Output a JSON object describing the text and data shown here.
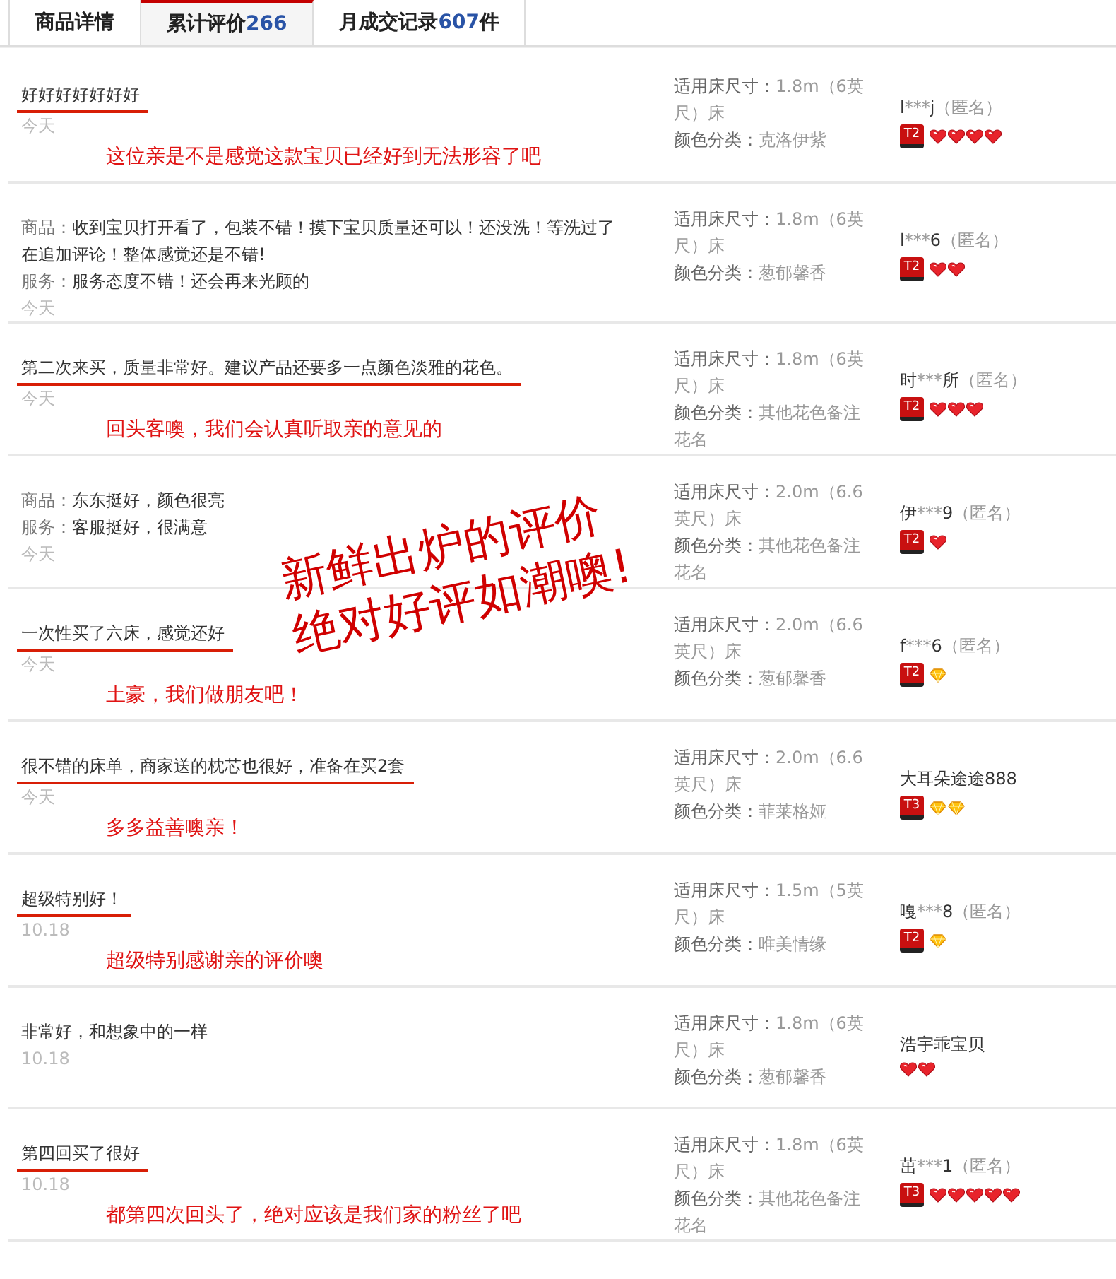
{
  "tabs": [
    {
      "label": "商品详情",
      "selected": false
    },
    {
      "label": "累计评价",
      "count": "266",
      "selected": true
    },
    {
      "label": "月成交记录",
      "count": "607",
      "suffix": "件",
      "selected": false
    }
  ],
  "reviews": [
    {
      "lines": [
        {
          "text": "好好好好好好好"
        }
      ],
      "date": "今天",
      "reply": "这位亲是不是感觉这款宝贝已经好到无法形容了吧",
      "size_label": "适用床尺寸：",
      "size": "1.8m（6英尺）床",
      "color_label": "颜色分类：",
      "color_name": "克洛伊紫",
      "user": {
        "head": "l",
        "mask": "***",
        "tail": "j",
        "anon": "（匿名）"
      },
      "badge": "T2",
      "rank_icons": [
        {
          "kind": "heart"
        },
        {
          "kind": "heart"
        },
        {
          "kind": "heart"
        },
        {
          "kind": "heart"
        }
      ]
    },
    {
      "lines": [
        {
          "label": "商品：",
          "text": "收到宝贝打开看了，包装不错！摸下宝贝质量还可以！还没洗！等洗过了在追加评论！整体感觉还是不错!"
        },
        {
          "label": "服务：",
          "text": "服务态度不错！还会再来光顾的"
        }
      ],
      "date": "今天",
      "size_label": "适用床尺寸：",
      "size": "1.8m（6英尺）床",
      "color_label": "颜色分类：",
      "color_name": "葱郁馨香",
      "user": {
        "head": "l",
        "mask": "***",
        "tail": "6",
        "anon": "（匿名）"
      },
      "badge": "T2",
      "rank_icons": [
        {
          "kind": "heart"
        },
        {
          "kind": "heart"
        }
      ]
    },
    {
      "lines": [
        {
          "text": "第二次来买，质量非常好。建议产品还要多一点颜色淡雅的花色。"
        }
      ],
      "date": "今天",
      "reply": "回头客噢，我们会认真听取亲的意见的",
      "size_label": "适用床尺寸：",
      "size": "1.8m（6英尺）床",
      "color_label": "颜色分类：",
      "color_name": "其他花色备注花名",
      "user": {
        "head": "时",
        "mask": "***",
        "tail": "所",
        "anon": "（匿名）"
      },
      "badge": "T2",
      "rank_icons": [
        {
          "kind": "heart"
        },
        {
          "kind": "heart"
        },
        {
          "kind": "heart"
        }
      ]
    },
    {
      "lines": [
        {
          "label": "商品：",
          "text": "东东挺好，颜色很亮"
        },
        {
          "label": "服务：",
          "text": "客服挺好，很满意"
        }
      ],
      "date": "今天",
      "size_label": "适用床尺寸：",
      "size": "2.0m（6.6英尺）床",
      "color_label": "颜色分类：",
      "color_name": "其他花色备注花名",
      "user": {
        "head": "伊",
        "mask": "***",
        "tail": "9",
        "anon": "（匿名）"
      },
      "badge": "T2",
      "rank_icons": [
        {
          "kind": "heart"
        }
      ]
    },
    {
      "lines": [
        {
          "text": "一次性买了六床，感觉还好"
        }
      ],
      "date": "今天",
      "reply": "土豪，我们做朋友吧！",
      "size_label": "适用床尺寸：",
      "size": "2.0m（6.6英尺）床",
      "color_label": "颜色分类：",
      "color_name": "葱郁馨香",
      "user": {
        "head": "f",
        "mask": "***",
        "tail": "6",
        "anon": "（匿名）"
      },
      "badge": "T2",
      "rank_icons": [
        {
          "kind": "diamond"
        }
      ]
    },
    {
      "lines": [
        {
          "text": "很不错的床单，商家送的枕芯也很好，准备在买2套"
        }
      ],
      "date": "今天",
      "reply": "多多益善噢亲！",
      "size_label": "适用床尺寸：",
      "size": "2.0m（6.6英尺）床",
      "color_label": "颜色分类：",
      "color_name": "菲莱格娅",
      "user": {
        "head": "大耳朵途途888"
      },
      "badge": "T3",
      "rank_icons": [
        {
          "kind": "diamond"
        },
        {
          "kind": "diamond"
        }
      ]
    },
    {
      "lines": [
        {
          "text": "超级特别好！"
        }
      ],
      "date": "10.18",
      "reply": "超级特别感谢亲的评价噢",
      "size_label": "适用床尺寸：",
      "size": "1.5m（5英尺）床",
      "color_label": "颜色分类：",
      "color_name": "唯美情缘",
      "user": {
        "head": "嘎",
        "mask": "***",
        "tail": "8",
        "anon": "（匿名）"
      },
      "badge": "T2",
      "rank_icons": [
        {
          "kind": "diamond"
        }
      ]
    },
    {
      "lines": [
        {
          "text": "非常好，和想象中的一样"
        }
      ],
      "date": "10.18",
      "size_label": "适用床尺寸：",
      "size": "1.8m（6英尺）床",
      "color_label": "颜色分类：",
      "color_name": "葱郁馨香",
      "user": {
        "head": "浩宇乖宝贝"
      },
      "rank_icons": [
        {
          "kind": "heart"
        },
        {
          "kind": "heart"
        }
      ]
    },
    {
      "lines": [
        {
          "text": "第四回买了很好"
        }
      ],
      "date": "10.18",
      "reply": "都第四次回头了，绝对应该是我们家的粉丝了吧",
      "size_label": "适用床尺寸：",
      "size": "1.8m（6英尺）床",
      "color_label": "颜色分类：",
      "color_name": "其他花色备注花名",
      "user": {
        "head": "茁",
        "mask": "***",
        "tail": "1",
        "anon": "（匿名）"
      },
      "badge": "T3",
      "rank_icons": [
        {
          "kind": "heart"
        },
        {
          "kind": "heart"
        },
        {
          "kind": "heart"
        },
        {
          "kind": "heart"
        },
        {
          "kind": "heart"
        }
      ]
    }
  ],
  "overlay": [
    "新鲜出炉的评价",
    "绝对好评如潮噢!"
  ]
}
